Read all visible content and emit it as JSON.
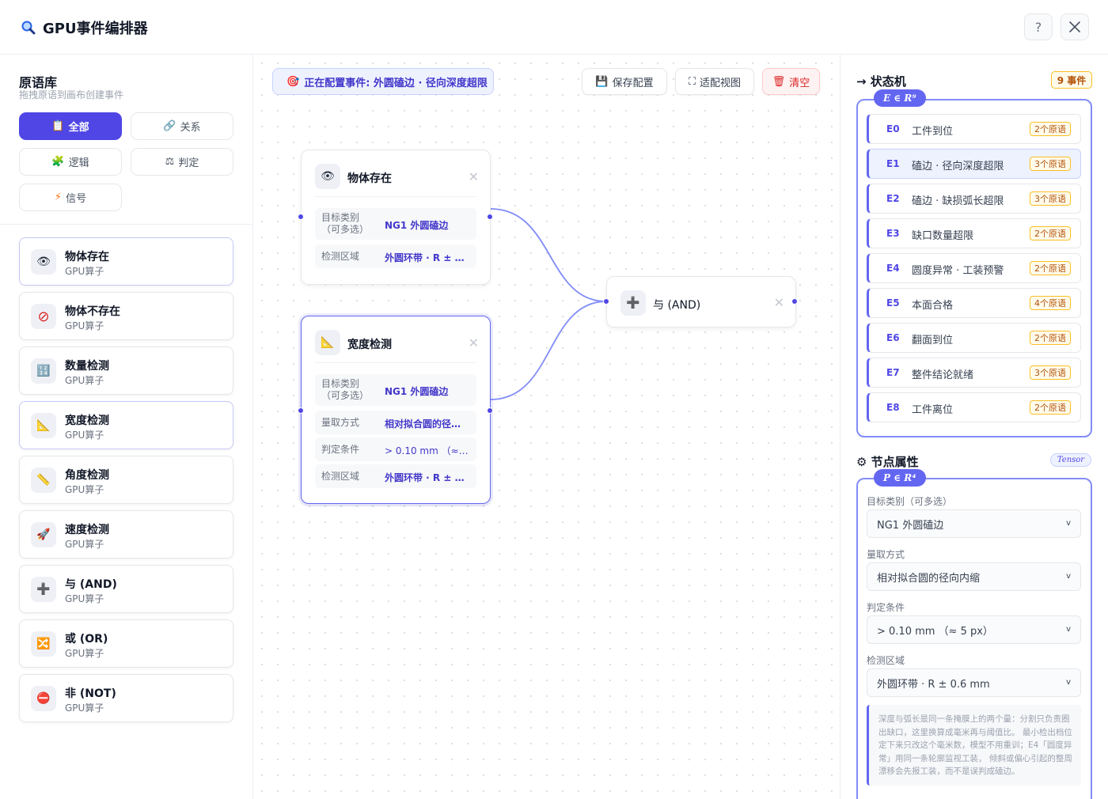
{
  "app": {
    "title": "GPU事件编排器",
    "help_label": "?",
    "close_label": "✕"
  },
  "library": {
    "title": "原语库",
    "subtitle": "拖拽原语到画布创建事件",
    "filters": [
      {
        "icon": "📋",
        "label": "全部"
      },
      {
        "icon": "🔗",
        "label": "关系"
      },
      {
        "icon": "🧩",
        "label": "逻辑"
      },
      {
        "icon": "⚖",
        "label": "判定"
      },
      {
        "icon": "⚡",
        "label": "信号"
      }
    ],
    "primitives": [
      {
        "icon": "👁",
        "name": "物体存在",
        "sub": "GPU算子"
      },
      {
        "icon": "⊘",
        "name": "物体不存在",
        "sub": "GPU算子"
      },
      {
        "icon": "🔢",
        "name": "数量检测",
        "sub": "GPU算子"
      },
      {
        "icon": "📐",
        "name": "宽度检测",
        "sub": "GPU算子"
      },
      {
        "icon": "📏",
        "name": "角度检测",
        "sub": "GPU算子"
      },
      {
        "icon": "🚀",
        "name": "速度检测",
        "sub": "GPU算子"
      },
      {
        "icon": "➕",
        "name": "与 (AND)",
        "sub": "GPU算子"
      },
      {
        "icon": "🔀",
        "name": "或 (OR)",
        "sub": "GPU算子"
      },
      {
        "icon": "⛔",
        "name": "非 (NOT)",
        "sub": "GPU算子"
      }
    ]
  },
  "canvas": {
    "config_icon": "🎯",
    "config_label": "正在配置事件: 外圆磕边 · 径向深度超限",
    "toolbar": {
      "save": {
        "icon": "💾",
        "label": "保存配置"
      },
      "fit": {
        "icon": "⛶",
        "label": "适配视图"
      },
      "clear": {
        "icon": "🗑",
        "label": "清空"
      }
    },
    "nodes": {
      "exists": {
        "icon": "👁",
        "title": "物体存在",
        "rows": [
          {
            "key": "目标类别\n（可多选）",
            "value": "NG1 外圆磕边"
          },
          {
            "key": "检测区域",
            "value": "外圆环带 · R ± 0.6 ..."
          }
        ]
      },
      "width": {
        "icon": "📐",
        "title": "宽度检测",
        "rows": [
          {
            "key": "目标类别\n（可多选）",
            "value": "NG1 外圆磕边"
          },
          {
            "key": "量取方式",
            "value": "相对拟合圆的径向..."
          },
          {
            "key": "判定条件",
            "value": "> 0.10 mm （≈ 5 p..."
          },
          {
            "key": "检测区域",
            "value": "外圆环带 · R ± 0.6 ..."
          }
        ]
      },
      "and": {
        "icon": "➕",
        "title": "与 (AND)"
      }
    }
  },
  "state_machine": {
    "title": "→ 状态机",
    "count_label": "9 事件",
    "formula": "E ∈ R⁹",
    "events": [
      {
        "id": "E0",
        "name": "工件到位",
        "count": "2个原语"
      },
      {
        "id": "E1",
        "name": "磕边 · 径向深度超限",
        "count": "3个原语"
      },
      {
        "id": "E2",
        "name": "磕边 · 缺损弧长超限",
        "count": "3个原语"
      },
      {
        "id": "E3",
        "name": "缺口数量超限",
        "count": "2个原语"
      },
      {
        "id": "E4",
        "name": "圆度异常 · 工装预警",
        "count": "2个原语"
      },
      {
        "id": "E5",
        "name": "本面合格",
        "count": "4个原语"
      },
      {
        "id": "E6",
        "name": "翻面到位",
        "count": "2个原语"
      },
      {
        "id": "E7",
        "name": "整件结论就绪",
        "count": "3个原语"
      },
      {
        "id": "E8",
        "name": "工件离位",
        "count": "2个原语"
      }
    ]
  },
  "node_props": {
    "title": "⚙ 节点属性",
    "tensor_label": "Tensor",
    "formula": "P ∈ R⁴",
    "fields": [
      {
        "label": "目标类别（可多选）",
        "value": "NG1 外圆磕边"
      },
      {
        "label": "量取方式",
        "value": "相对拟合圆的径向内缩"
      },
      {
        "label": "判定条件",
        "value": "> 0.10 mm （≈ 5 px）"
      },
      {
        "label": "检测区域",
        "value": "外圆环带 · R ± 0.6 mm"
      }
    ],
    "note": "深度与弧长是同一条掩膜上的两个量：分割只负责圈出缺口，这里换算成毫米再与阈值比。 最小检出档位定下来只改这个毫米数，模型不用重训；E4「圆度异常」用同一条轮廓监视工装， 倾斜或偏心引起的整周漂移会先报工装，而不是误判成磕边。"
  }
}
